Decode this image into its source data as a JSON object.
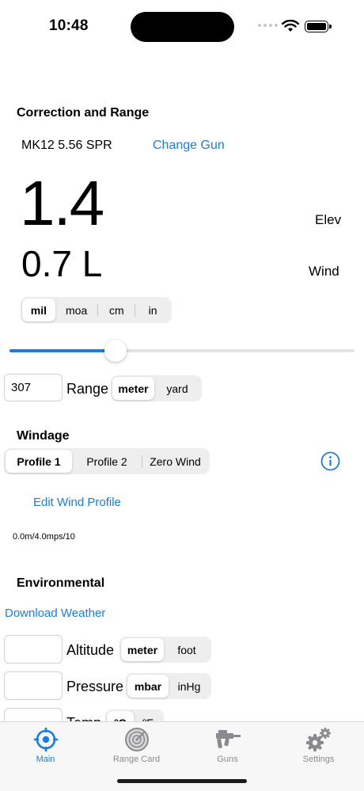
{
  "status": {
    "time": "10:48"
  },
  "correction": {
    "section_title": "Correction and Range",
    "gun_name": "MK12 5.56 SPR",
    "change_gun": "Change Gun",
    "elev_value": "1.4",
    "elev_label": "Elev",
    "wind_value": "0.7 L",
    "wind_label": "Wind",
    "units": [
      "mil",
      "moa",
      "cm",
      "in"
    ],
    "selected_unit": "mil",
    "range_slider_level": 0.31
  },
  "range": {
    "value": "307",
    "label": "Range",
    "units": [
      "meter",
      "yard"
    ],
    "selected_unit": "meter"
  },
  "windage": {
    "section_title": "Windage",
    "profiles": [
      "Profile 1",
      "Profile 2",
      "Zero Wind"
    ],
    "selected_profile": "Profile 1",
    "edit_link": "Edit Wind Profile",
    "summary": "0.0m/4.0mps/10"
  },
  "environmental": {
    "section_title": "Environmental",
    "download_link": "Download Weather",
    "altitude": {
      "label": "Altitude",
      "value": "",
      "units": [
        "meter",
        "foot"
      ],
      "selected_unit": "meter"
    },
    "pressure": {
      "label": "Pressure",
      "value": "",
      "units": [
        "mbar",
        "inHg"
      ],
      "selected_unit": "mbar"
    },
    "temp": {
      "label": "Temp",
      "value": "",
      "units": [
        "ºC",
        "ºF"
      ],
      "selected_unit": "ºC"
    }
  },
  "tabs": [
    {
      "label": "Main",
      "icon": "crosshair-icon",
      "active": true
    },
    {
      "label": "Range Card",
      "icon": "radar-icon",
      "active": false
    },
    {
      "label": "Guns",
      "icon": "rifle-icon",
      "active": false
    },
    {
      "label": "Settings",
      "icon": "gears-icon",
      "active": false
    }
  ],
  "colors": {
    "accent": "#1a7ee0",
    "inactive": "#8a8a8e"
  }
}
